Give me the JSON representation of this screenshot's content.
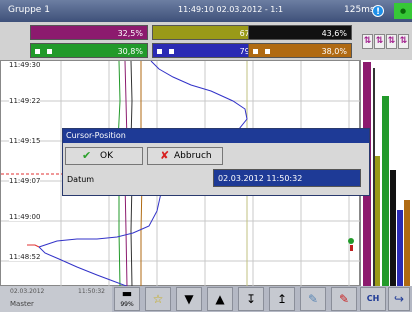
{
  "header": {
    "group": "Gruppe 1",
    "datetime": "11:49:10 02.03.2012 - 1:1",
    "interval": "125ms",
    "info_glyph": "!",
    "status_glyph": "●"
  },
  "values": [
    {
      "text": "32,5%",
      "color": "#8c1a6e"
    },
    {
      "text": "67,6%",
      "color": "#9a9a18"
    },
    {
      "text": "43,6%",
      "color": "#111111"
    },
    {
      "text": "30,8%",
      "color": "#229a2a"
    },
    {
      "text": "79,1%",
      "color": "#2a2ab4"
    },
    {
      "text": "38,0%",
      "color": "#b06a12"
    }
  ],
  "time_labels": [
    "11:49:30",
    "11:49:22",
    "11:49:15",
    "11:49:07",
    "11:49:00",
    "11:48:52"
  ],
  "dialog": {
    "title": "Cursor-Position",
    "ok_label": "OK",
    "cancel_label": "Abbruch",
    "date_label": "Datum",
    "date_value": "02.03.2012 11:50:32"
  },
  "toolbar": {
    "date": "02.03.2012",
    "time": "11:50:32",
    "mode": "Master",
    "zoom": "99%"
  }
}
